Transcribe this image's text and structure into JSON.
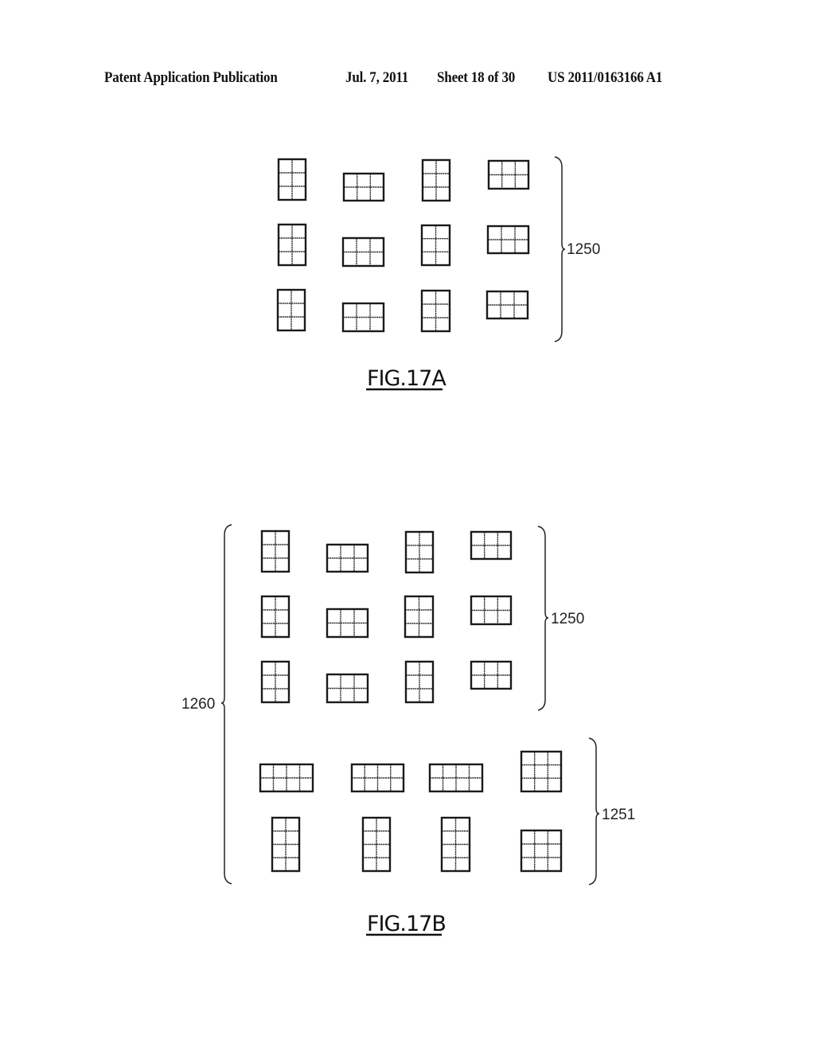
{
  "header": {
    "title": "Patent Application Publication",
    "date": "Jul. 7, 2011",
    "sheet": "Sheet 18 of 30",
    "publication_number": "US 2011/0163166 A1"
  },
  "figures": [
    {
      "id": "fig17a",
      "caption": "FIG.17A",
      "groups": [
        {
          "reference": "1250",
          "label_side": "right",
          "rows": [
            [
              {
                "cols": 2,
                "rows": 3
              },
              {
                "cols": 3,
                "rows": 2
              },
              {
                "cols": 2,
                "rows": 3
              },
              {
                "cols": 3,
                "rows": 2
              }
            ],
            [
              {
                "cols": 2,
                "rows": 3
              },
              {
                "cols": 3,
                "rows": 2
              },
              {
                "cols": 2,
                "rows": 3
              },
              {
                "cols": 3,
                "rows": 2
              }
            ],
            [
              {
                "cols": 2,
                "rows": 3
              },
              {
                "cols": 3,
                "rows": 2
              },
              {
                "cols": 2,
                "rows": 3
              },
              {
                "cols": 3,
                "rows": 2
              }
            ]
          ]
        }
      ]
    },
    {
      "id": "fig17b",
      "caption": "FIG.17B",
      "outer_reference": "1260",
      "groups": [
        {
          "reference": "1250",
          "label_side": "right",
          "rows": [
            [
              {
                "cols": 2,
                "rows": 3
              },
              {
                "cols": 3,
                "rows": 2
              },
              {
                "cols": 2,
                "rows": 3
              },
              {
                "cols": 3,
                "rows": 2
              }
            ],
            [
              {
                "cols": 2,
                "rows": 3
              },
              {
                "cols": 3,
                "rows": 2
              },
              {
                "cols": 2,
                "rows": 3
              },
              {
                "cols": 3,
                "rows": 2
              }
            ],
            [
              {
                "cols": 2,
                "rows": 3
              },
              {
                "cols": 3,
                "rows": 2
              },
              {
                "cols": 2,
                "rows": 3
              },
              {
                "cols": 3,
                "rows": 2
              }
            ]
          ]
        },
        {
          "reference": "1251",
          "label_side": "right",
          "rows": [
            [
              {
                "cols": 4,
                "rows": 2
              },
              {
                "cols": 4,
                "rows": 2
              },
              {
                "cols": 4,
                "rows": 2
              },
              {
                "cols": 3,
                "rows": 3
              }
            ],
            [
              {
                "cols": 2,
                "rows": 4
              },
              {
                "cols": 2,
                "rows": 4
              },
              {
                "cols": 2,
                "rows": 4
              },
              {
                "cols": 3,
                "rows": 3
              }
            ]
          ]
        }
      ]
    }
  ]
}
